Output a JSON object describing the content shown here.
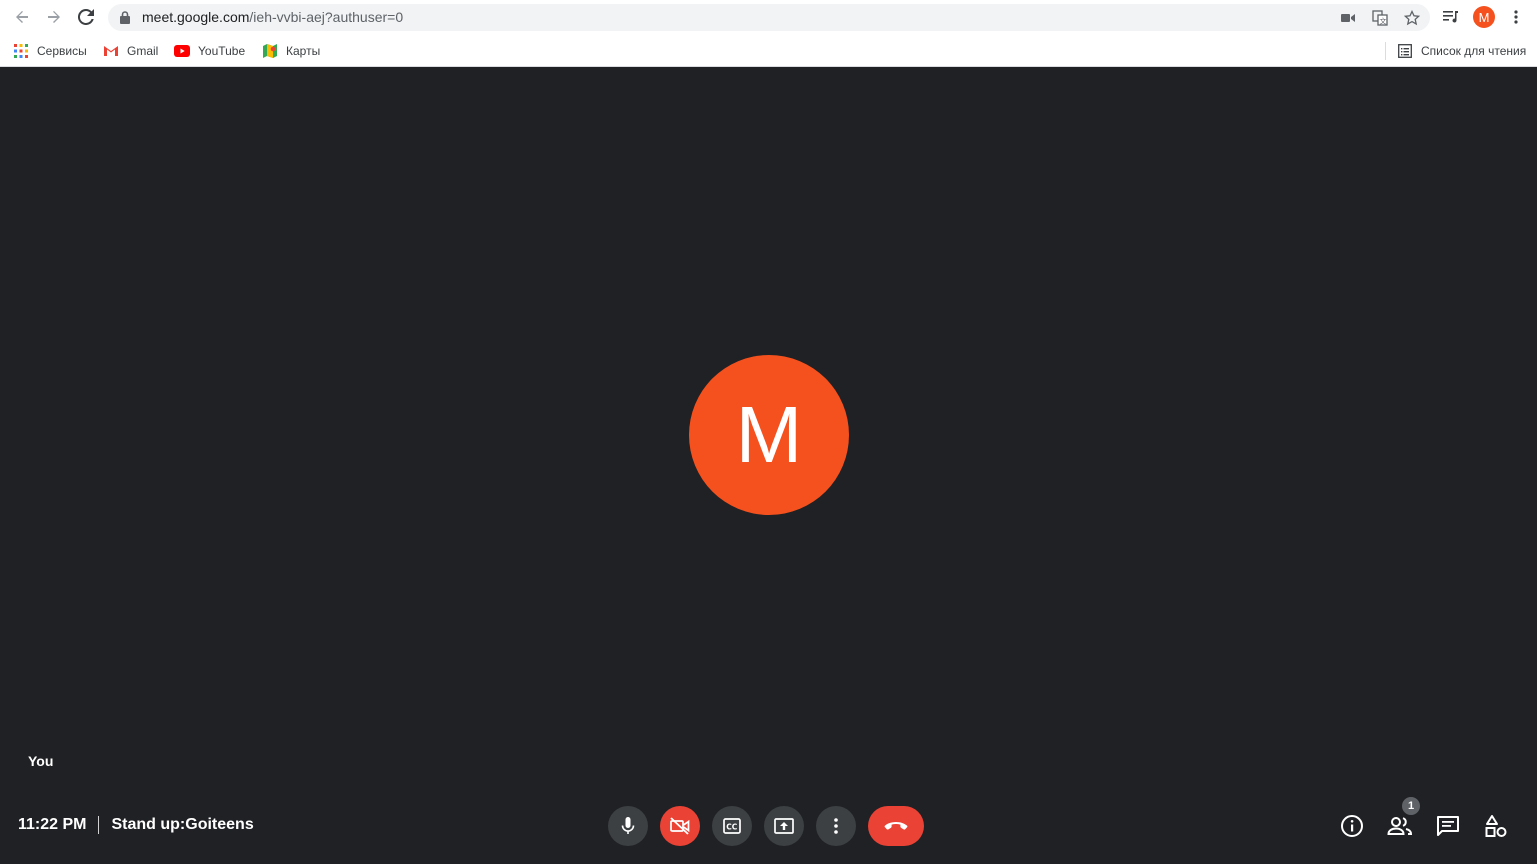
{
  "browser": {
    "url_host": "meet.google.com",
    "url_path": "/ieh-vvbi-aej?authuser=0",
    "profile_initial": "M",
    "bookmarks": [
      {
        "label": "Сервисы",
        "icon": "apps-grid-icon"
      },
      {
        "label": "Gmail",
        "icon": "gmail-icon"
      },
      {
        "label": "YouTube",
        "icon": "youtube-icon"
      },
      {
        "label": "Карты",
        "icon": "maps-icon"
      }
    ],
    "reading_list_label": "Список для чтения"
  },
  "meet": {
    "avatar_initial": "M",
    "self_label": "You",
    "time": "11:22 PM",
    "meeting_title": "Stand up:Goiteens",
    "participants_count": "1",
    "colors": {
      "background": "#202124",
      "avatar": "#f4511e",
      "danger": "#ea4335",
      "control": "#3c4043"
    }
  }
}
